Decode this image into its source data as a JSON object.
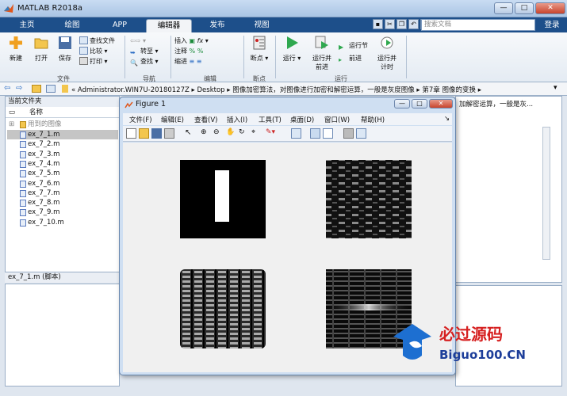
{
  "window": {
    "title": "MATLAB R2018a",
    "min": "—",
    "max": "□",
    "close": "✕"
  },
  "tabs": [
    "主页",
    "绘图",
    "APP",
    "编辑器",
    "发布",
    "视图"
  ],
  "active_tab": "编辑器",
  "search_placeholder": "搜索文档",
  "login": "登录",
  "toolstrip": {
    "file": {
      "new": "新建",
      "open": "打开",
      "save": "保存",
      "find_files": "查找文件",
      "compare": "比较",
      "print": "打印",
      "group": "文件"
    },
    "navigate": {
      "goto": "转至",
      "find": "查找",
      "group": "导航"
    },
    "edit": {
      "insert": "插入",
      "comment": "注释",
      "indent": "缩进",
      "group": "编辑"
    },
    "breakpoints": {
      "label": "断点",
      "group": "断点"
    },
    "run": {
      "run": "运行",
      "run_advance": "运行并\n前进",
      "run_section": "运行节",
      "advance": "前进",
      "run_time": "运行并\n计时",
      "group": "运行"
    }
  },
  "address": {
    "path": "« Administrator.WIN7U-20180127Z  ▸  Desktop  ▸  图像加密算法，对图像进行加密和解密运算，一般是灰度图像  ▸  第7章 图像的变换  ▸"
  },
  "current_folder": {
    "title": "当前文件夹",
    "col_name": "名称",
    "folder": "用到的图像",
    "files": [
      "ex_7_1.m",
      "ex_7_2.m",
      "ex_7_3.m",
      "ex_7_4.m",
      "ex_7_5.m",
      "ex_7_6.m",
      "ex_7_7.m",
      "ex_7_8.m",
      "ex_7_9.m",
      "ex_7_10.m"
    ],
    "selected": "ex_7_1.m"
  },
  "detail": {
    "text": "ex_7_1.m  (脚本)"
  },
  "right_panel": {
    "text": "加解密运算，一般是灰..."
  },
  "figure": {
    "title": "Figure 1",
    "menu": [
      "文件(F)",
      "编辑(E)",
      "查看(V)",
      "插入(I)",
      "工具(T)",
      "桌面(D)",
      "窗口(W)",
      "帮助(H)"
    ]
  },
  "watermark": {
    "cn": "必过源码",
    "en": "Biguo100.CN"
  },
  "colors": {
    "tabbar": "#1d4f8a",
    "accent": "#2a6cc4"
  }
}
